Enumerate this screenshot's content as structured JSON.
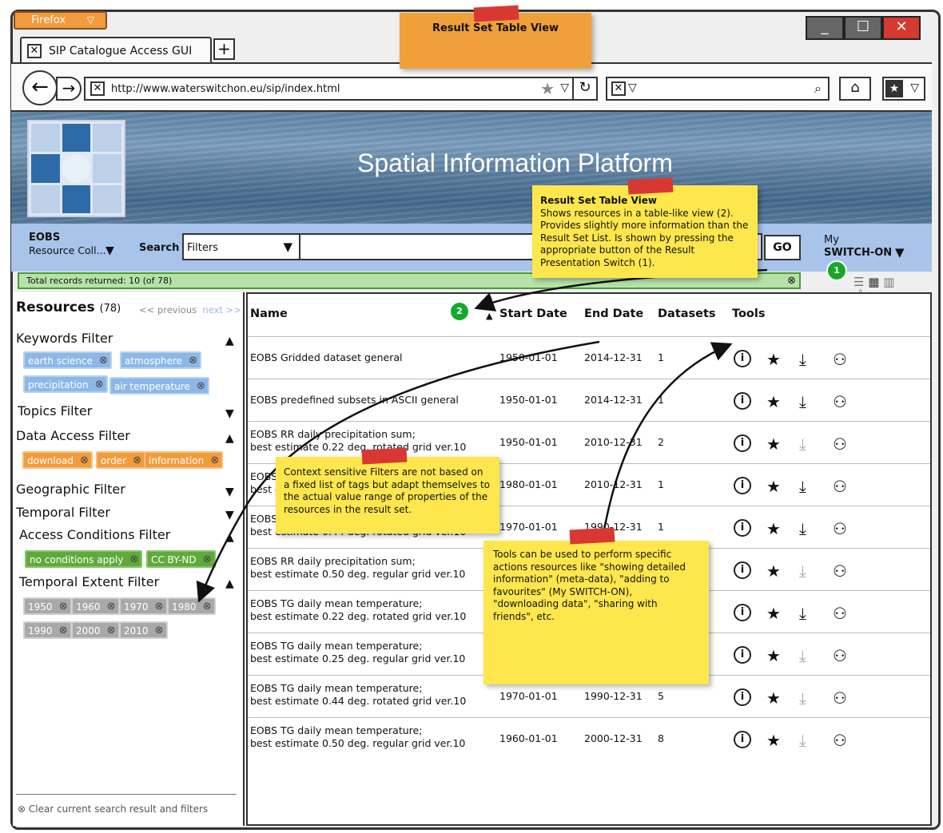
{
  "browser": {
    "app_button": "Firefox",
    "tab_title": "SIP Catalogue Access GUI",
    "url": "http://www.waterswitchon.eu/sip/index.html"
  },
  "banner": {
    "title": "Spatial Information Platform"
  },
  "searchbar": {
    "catalog_name": "EOBS",
    "catalog_sub": "Resource Coll...",
    "search_label": "Search",
    "filter_select": "Filters",
    "go_label": "GO",
    "my_label": "My",
    "my_name": "SWITCH-ON"
  },
  "status": {
    "text": "Total records returned: 10 (of 78)"
  },
  "left": {
    "resources_label": "Resources",
    "resources_count": "(78)",
    "prev": "<< previous",
    "next": "next >>",
    "filters": [
      {
        "label": "Keywords Filter",
        "arrow": "▲"
      },
      {
        "label": "Topics Filter",
        "arrow": "▼"
      },
      {
        "label": "Data Access Filter",
        "arrow": "▲"
      },
      {
        "label": "Geographic Filter",
        "arrow": "▼"
      },
      {
        "label": "Temporal Filter",
        "arrow": "▼"
      },
      {
        "label": "Access Conditions Filter",
        "arrow": "▲"
      },
      {
        "label": "Temporal Extent Filter",
        "arrow": "▲"
      }
    ],
    "keyword_tags": [
      "earth science",
      "atmosphere",
      "precipitation",
      "air temperature"
    ],
    "access_tags": [
      "download",
      "order",
      "information"
    ],
    "conditions_tags": [
      "no conditions apply",
      "CC BY-ND"
    ],
    "year_tags": [
      "1950",
      "1960",
      "1970",
      "1980",
      "1990",
      "2000",
      "2010"
    ],
    "clear": "Clear current search result and filters"
  },
  "table": {
    "headers": {
      "name": "Name",
      "start": "Start Date",
      "end": "End Date",
      "datasets": "Datasets",
      "tools": "Tools"
    },
    "rows": [
      {
        "name": "EOBS Gridded dataset general",
        "start": "1950-01-01",
        "end": "2014-12-31",
        "datasets": "1",
        "download_enabled": true
      },
      {
        "name": "EOBS predefined subsets in ASCII general",
        "start": "1950-01-01",
        "end": "2014-12-31",
        "datasets": "1",
        "download_enabled": true
      },
      {
        "name": "EOBS RR daily precipitation sum;\nbest estimate 0.22 deg. rotated grid ver.10",
        "start": "1950-01-01",
        "end": "2010-12-31",
        "datasets": "2",
        "download_enabled": false
      },
      {
        "name": "EOBS RR daily precipitation sum;\nbest estimate 0.25 deg. regular grid ver.10",
        "start": "1980-01-01",
        "end": "2010-12-31",
        "datasets": "1",
        "download_enabled": true
      },
      {
        "name": "EOBS RR daily precipitation sum;\nbest estimate 0.44 deg. rotated grid ver.10",
        "start": "1970-01-01",
        "end": "1990-12-31",
        "datasets": "1",
        "download_enabled": true
      },
      {
        "name": "EOBS RR daily precipitation sum;\nbest estimate 0.50 deg. regular grid ver.10",
        "start": "",
        "end": "",
        "datasets": "",
        "download_enabled": false
      },
      {
        "name": "EOBS TG daily mean temperature;\nbest estimate 0.22 deg. rotated grid ver.10",
        "start": "",
        "end": "",
        "datasets": "",
        "download_enabled": true
      },
      {
        "name": "EOBS TG daily mean temperature;\nbest estimate 0.25 deg. regular grid ver.10",
        "start": "",
        "end": "",
        "datasets": "",
        "download_enabled": false
      },
      {
        "name": "EOBS TG daily mean temperature;\nbest estimate 0.44 deg. rotated grid ver.10",
        "start": "1970-01-01",
        "end": "1990-12-31",
        "datasets": "5",
        "download_enabled": false
      },
      {
        "name": "EOBS TG daily mean temperature;\nbest estimate 0.50 deg. regular grid ver.10",
        "start": "1960-01-01",
        "end": "2000-12-31",
        "datasets": "8",
        "download_enabled": false
      }
    ]
  },
  "notes": {
    "top_title": "Result Set Table View",
    "table_view_title": "Result Set Table View",
    "table_view_body": "Shows resources in a table-like view (2). Provides slightly more information than the Result Set List. Is shown by pressing the appropriate button of the Result Presentation Switch (1).",
    "filters_note": "Context sensitive Filters are not based on a fixed list of tags but adapt themselves to the actual value range of properties of the resources in the result set.",
    "tools_note": "Tools can be used to perform specific actions resources like \"showing detailed information\" (meta-data), \"adding to favourites\" (My SWITCH-ON), \"downloading data\", \"sharing with friends\", etc.",
    "badge1": "1",
    "badge2": "2"
  },
  "colors": {
    "banner_blue": "#6a8fb3",
    "search_bar": "#a8c4ea",
    "note_yellow": "#fde74c",
    "tape_red": "#d93832",
    "badge_green": "#16a82b"
  }
}
